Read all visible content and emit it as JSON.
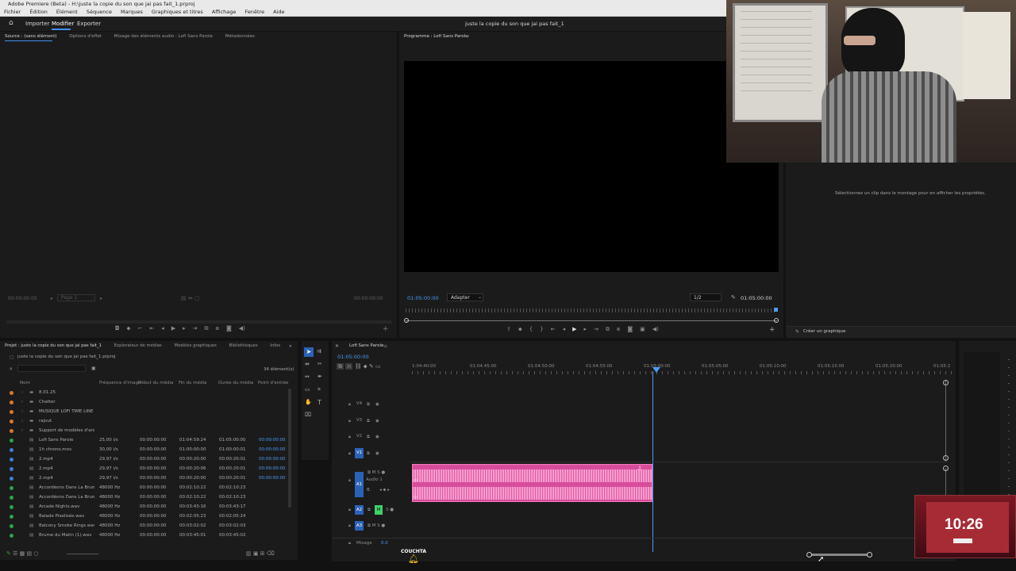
{
  "window": {
    "app_title": "Adobe Premiere (Beta) - H:\\juste la copie du son que jai pas fait_1.prproj",
    "doc_title": "juste la copie du son que jai pas fait_1"
  },
  "menu": [
    "Fichier",
    "Édition",
    "Élément",
    "Séquence",
    "Marques",
    "Graphiques et titres",
    "Affichage",
    "Fenêtre",
    "Aide"
  ],
  "workspace": {
    "tabs": [
      "Importer",
      "Modifier",
      "Exporter"
    ],
    "active": "Modifier"
  },
  "source_panel": {
    "tabs": [
      "Source : (sans élément)",
      "Options d'effet",
      "Mixage des éléments audio : Lofi Sans Parole",
      "Métadonnées"
    ],
    "timecode_left": "00:00:00:00",
    "page": "Page 1",
    "timecode_right": "00:00:00:00"
  },
  "program_panel": {
    "title": "Programme : Lofi Sans Parole",
    "timecode": "01:05:00:00",
    "fit": "Adapter",
    "resolution": "1/2",
    "duration": "01:05:00:00"
  },
  "properties": {
    "message": "Sélectionnez un clip dans le montage pour en afficher les propriétés.",
    "create_graphic": "Créer un graphique"
  },
  "project_panel": {
    "tabs": [
      "Projet : juste la copie du son que jai pas fait_1",
      "Explorateur de médias",
      "Modèles graphiques",
      "Bibliothèques",
      "Infos"
    ],
    "path": "juste la copie du son que jai pas fait_1.prproj",
    "count": "34 élément(s)",
    "columns": [
      "Nom",
      "Fréquence d'image",
      "Début du média",
      "Fin du média",
      "Durée du média",
      "Point d'entrée"
    ],
    "rows": [
      {
        "color": "#d67a2a",
        "name": "8.01.25",
        "fps": "",
        "start": "",
        "end": "",
        "dur": "",
        "in": ""
      },
      {
        "color": "#d67a2a",
        "name": "Chatter",
        "fps": "",
        "start": "",
        "end": "",
        "dur": "",
        "in": ""
      },
      {
        "color": "#d67a2a",
        "name": "MUSIQUE LOFI TIME LINE",
        "fps": "",
        "start": "",
        "end": "",
        "dur": "",
        "in": ""
      },
      {
        "color": "#d67a2a",
        "name": "rajout",
        "fps": "",
        "start": "",
        "end": "",
        "dur": "",
        "in": ""
      },
      {
        "color": "#d67a2a",
        "name": "Support de modèles d'anima",
        "fps": "",
        "start": "",
        "end": "",
        "dur": "",
        "in": ""
      },
      {
        "color": "#2fa24a",
        "name": "Lofi Sans Parole",
        "fps": "25,00 i/s",
        "start": "00:00:00:00",
        "end": "01:04:59:24",
        "dur": "01:05:00:00",
        "in": "00:00:00:00"
      },
      {
        "color": "#3f7fd0",
        "name": "1h chrono.mov",
        "fps": "30,00 i/s",
        "start": "00:00:00:00",
        "end": "01:00:00:00",
        "dur": "01:00:00:01",
        "in": "00:00:00:00"
      },
      {
        "color": "#3f7fd0",
        "name": "2.mp4",
        "fps": "29,97 i/s",
        "start": "00:00:00:00",
        "end": "00:00:20:00",
        "dur": "00:00:20:01",
        "in": "00:00:00:00"
      },
      {
        "color": "#3f7fd0",
        "name": "2.mp4",
        "fps": "29,97 i/s",
        "start": "00:00:00:00",
        "end": "00:00:20:06",
        "dur": "00:00:20:01",
        "in": "00:00:00:00"
      },
      {
        "color": "#3f7fd0",
        "name": "2.mp4",
        "fps": "29,97 i/s",
        "start": "00:00:00:00",
        "end": "00:00:20:00",
        "dur": "00:00:20:01",
        "in": "00:00:00:00"
      },
      {
        "color": "#2fa24a",
        "name": "Accordéons Dans La Brume (",
        "fps": "48000 Hz",
        "start": "00:00:00:00",
        "end": "00:02:10:22",
        "dur": "00:02:10:23",
        "in": ""
      },
      {
        "color": "#2fa24a",
        "name": "Accordéons Dans La Brume",
        "fps": "48000 Hz",
        "start": "00:00:00:00",
        "end": "00:02:10:22",
        "dur": "00:02:10:23",
        "in": ""
      },
      {
        "color": "#2fa24a",
        "name": "Arcade Nights.wav",
        "fps": "48000 Hz",
        "start": "00:00:00:00",
        "end": "00:03:43:16",
        "dur": "00:03:43:17",
        "in": ""
      },
      {
        "color": "#2fa24a",
        "name": "Balade Pixelisée.wav",
        "fps": "48000 Hz",
        "start": "00:00:00:00",
        "end": "00:02:05:23",
        "dur": "00:02:05:24",
        "in": ""
      },
      {
        "color": "#2fa24a",
        "name": "Balcony Smoke Rings.wav",
        "fps": "48000 Hz",
        "start": "00:00:00:00",
        "end": "00:03:02:02",
        "dur": "00:03:02:03",
        "in": ""
      },
      {
        "color": "#2fa24a",
        "name": "Brume du Matin (1).wav",
        "fps": "48000 Hz",
        "start": "00:00:00:00",
        "end": "00:03:45:01",
        "dur": "00:03:45:02",
        "in": ""
      }
    ]
  },
  "timeline": {
    "sequence": "Lofi Sans Parole",
    "timecode": "01:05:00:00",
    "ruler": [
      "1:04:40:00",
      "01:04:45:00",
      "01:04:50:00",
      "01:04:55:00",
      "01:05:00:00",
      "01:05:05:00",
      "01:05:10:00",
      "01:05:15:00",
      "01:05:20:00",
      "01:05:2"
    ],
    "video_tracks": [
      "V4",
      "V3",
      "V2",
      "V1"
    ],
    "audio_tracks": [
      "A1",
      "A2",
      "A3"
    ],
    "audio1_name": "Audio 1",
    "audio1_level": "0.",
    "master_label": "Mixage",
    "master_value": "0.0",
    "clip_color": "#e44fa2"
  },
  "overlay": {
    "caption": "COUCHTA",
    "clock": "10:26"
  }
}
